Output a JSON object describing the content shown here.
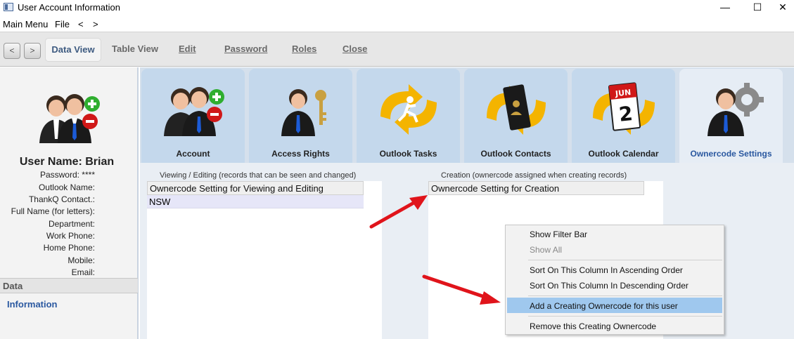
{
  "window": {
    "title": "User Account Information",
    "minimize_glyph": "—",
    "maximize_glyph": "☐",
    "close_glyph": "✕"
  },
  "menu": {
    "main_menu": "Main Menu",
    "file": "File",
    "back": "<",
    "forward": ">"
  },
  "toolbar": {
    "back_glyph": "<",
    "forward_glyph": ">",
    "items": [
      "Data View",
      "Table View",
      "Edit",
      "Password",
      "Roles",
      "Close"
    ]
  },
  "user": {
    "username": "User Name: Brian",
    "fields": [
      "Password: ****",
      "Outlook Name:",
      "ThankQ Contact.:",
      "Full Name (for letters):",
      "Department:",
      "Work Phone:",
      "Home Phone:",
      "Mobile:",
      "Email:"
    ]
  },
  "left_sections": {
    "data": "Data",
    "information": "Information"
  },
  "tabs": [
    "Account",
    "Access Rights",
    "Outlook Tasks",
    "Outlook Contacts",
    "Outlook Calendar",
    "Ownercode Settings"
  ],
  "calendar_icon": {
    "month": "JUN",
    "day": "2"
  },
  "viewing": {
    "group_label": "Viewing / Editing (records that can be seen and changed)",
    "column_header": "Ownercode Setting for Viewing and Editing",
    "rows": [
      "NSW"
    ]
  },
  "creation": {
    "group_label": "Creation (ownercode assigned when creating records)",
    "column_header": "Ownercode Setting for Creation",
    "rows": []
  },
  "context_menu": {
    "items": [
      "Show Filter Bar",
      "Show All",
      "Sort On This Column In Ascending Order",
      "Sort On This Column In Descending Order",
      "Add a Creating Ownercode for this user",
      "Remove this Creating Ownercode"
    ],
    "highlighted_index": 4,
    "disabled_index": 1
  },
  "colors": {
    "accent_blue": "#2a58a0",
    "tab_bg": "#c4d8ec",
    "highlight": "#9fc8ee",
    "annotation_arrow": "#e0141b"
  }
}
